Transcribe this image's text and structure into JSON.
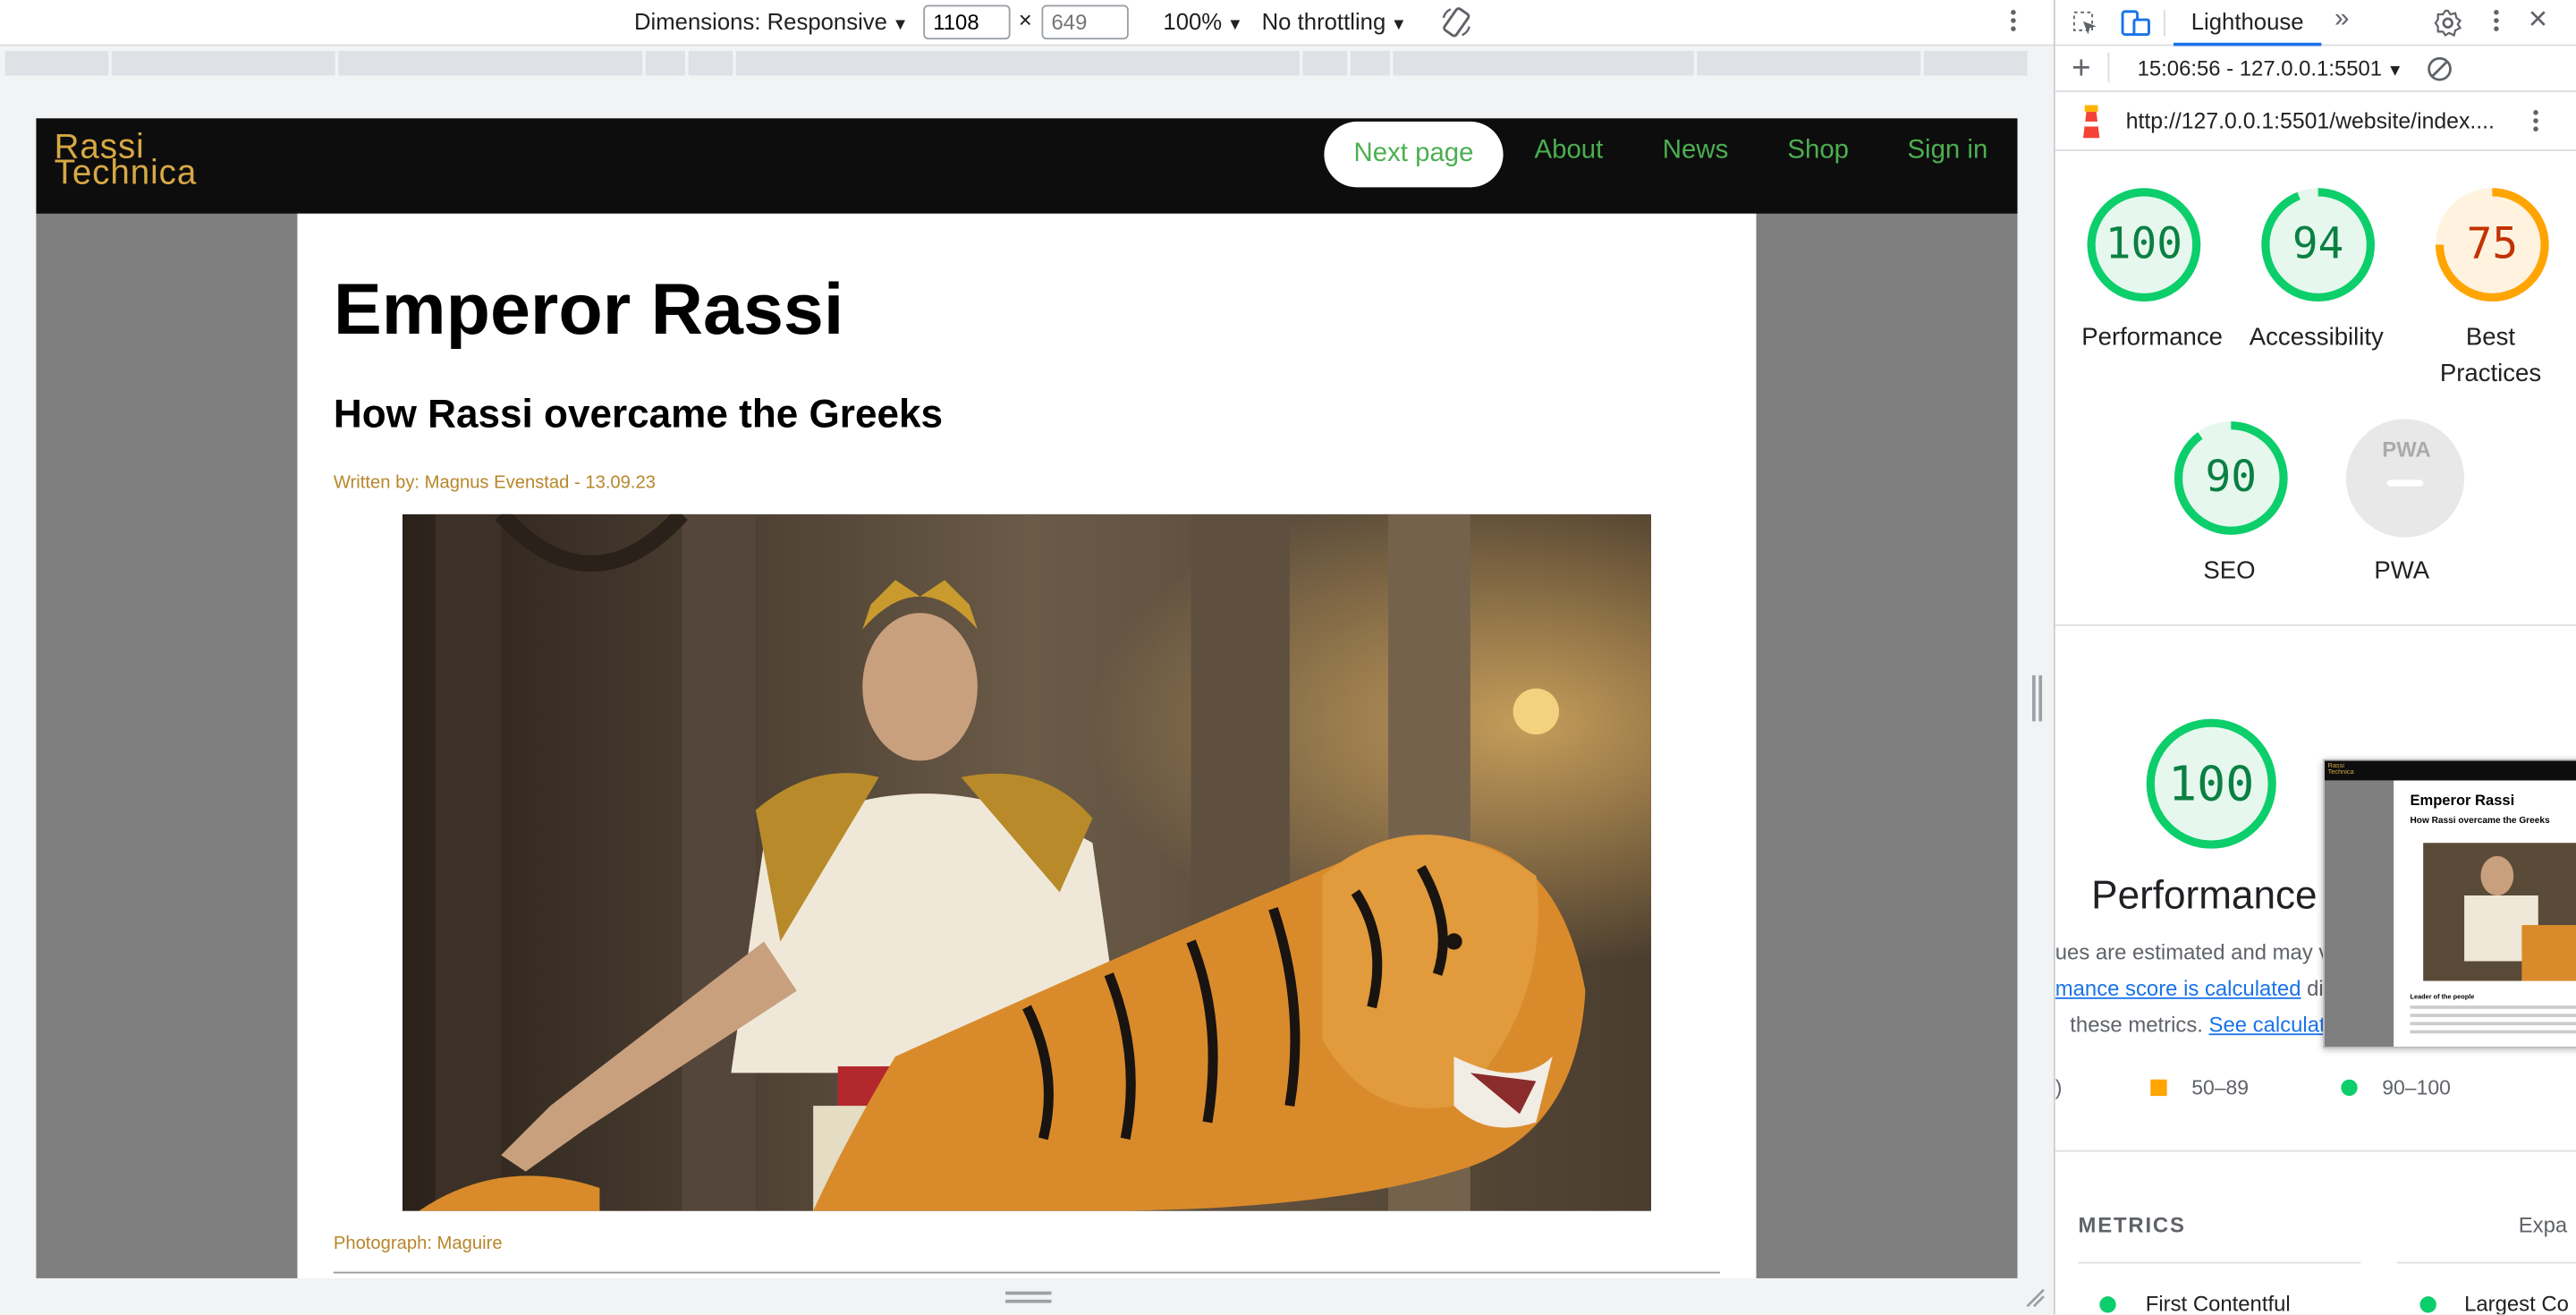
{
  "device_toolbar": {
    "dimensions_label": "Dimensions: Responsive",
    "width": "1108",
    "height_placeholder": "649",
    "zoom": "100%",
    "throttling": "No throttling"
  },
  "site": {
    "logo_line1": "Rassi",
    "logo_line2": "Technica",
    "nav": {
      "next_page": "Next page",
      "about": "About",
      "news": "News",
      "shop": "Shop",
      "sign_in": "Sign in"
    },
    "article": {
      "title": "Emperor Rassi",
      "subtitle": "How Rassi overcame the Greeks",
      "byline": "Written by: Magnus Evenstad - 13.09.23",
      "caption": "Photograph: Maguire"
    }
  },
  "devtools": {
    "tab": "Lighthouse",
    "report_time": "15:06:56 - 127.0.0.1:5501",
    "url": "http://127.0.0.1:5501/website/index....",
    "scores": [
      {
        "label": "Performance",
        "value": "100",
        "color": "#0cce6b"
      },
      {
        "label": "Accessibility",
        "value": "94",
        "color": "#0cce6b"
      },
      {
        "label": "Best Practices",
        "value": "75",
        "color": "#ffa400"
      },
      {
        "label": "SEO",
        "value": "90",
        "color": "#0cce6b"
      }
    ],
    "pwa_label": "PWA",
    "pwa_badge": "PWA",
    "perf_score": "100",
    "perf_title": "Performance",
    "desc_line1": "ues are estimated and may va",
    "desc_link1": "mance score is calculated",
    "desc_after1": " di",
    "desc_line3": "these metrics. ",
    "desc_link2": "See calculato",
    "legend_mid": "50–89",
    "legend_high": "90–100",
    "legend_low_partial": ")",
    "metrics_heading": "METRICS",
    "expand": "Expa",
    "metric_fcp": "First Contentful",
    "metric_lcp": "Largest Co",
    "thumb": {
      "title": "Emperor Rassi",
      "subtitle": "How Rassi overcame the Greeks",
      "section": "Leader of the people",
      "logo1": "Rassi",
      "logo2": "Technica"
    }
  }
}
